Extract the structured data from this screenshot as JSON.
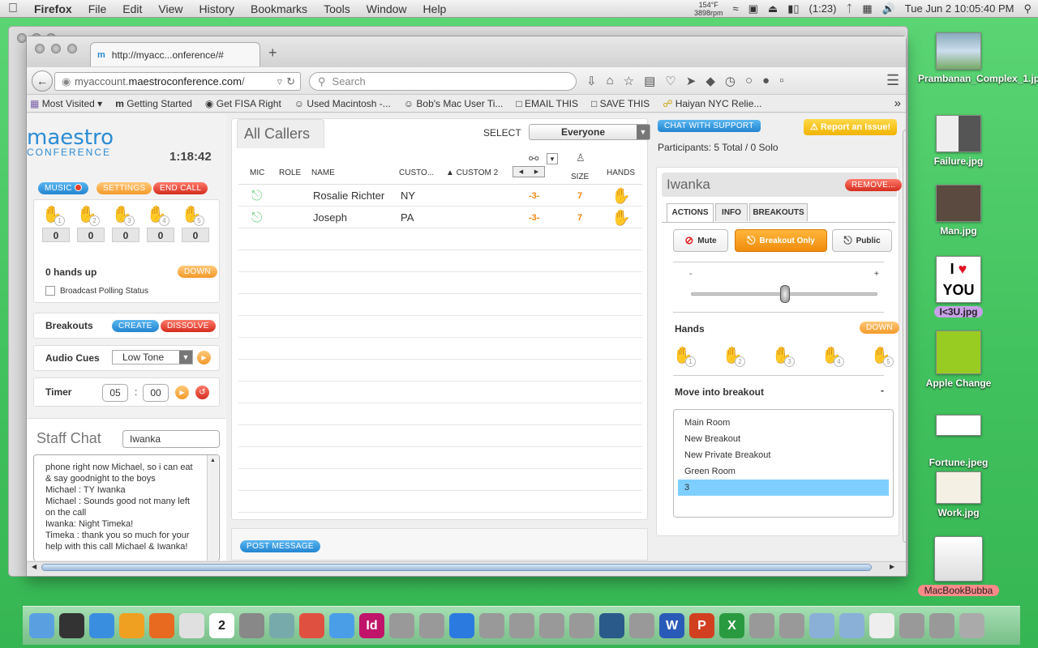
{
  "menubar": {
    "app": "Firefox",
    "items": [
      "File",
      "Edit",
      "View",
      "History",
      "Bookmarks",
      "Tools",
      "Window",
      "Help"
    ],
    "temp_line1": "154°F",
    "temp_line2": "3898rpm",
    "battery": "(1:23)",
    "datetime": "Tue Jun 2  10:05:40 PM"
  },
  "browser": {
    "tab_title": "http://myacc...onference/#",
    "new_tab": "+",
    "url_domain": "myaccount.",
    "url_bold": "maestroconference.com",
    "url_rest": "/",
    "search_placeholder": "Search",
    "bookmarks": [
      "Most Visited ▾",
      "Getting Started",
      "Get FISA Right",
      "Used Macintosh -...",
      "Bob's Mac User Ti...",
      "EMAIL THIS",
      "SAVE THIS",
      "Haiyan NYC Relie..."
    ],
    "overflow": "»"
  },
  "left": {
    "logo_top": "maestro",
    "logo_bottom": "CONFERENCE",
    "timer": "1:18:42",
    "music_label": "MUSIC",
    "settings_label": "SETTINGS",
    "end_call_label": "END CALL",
    "hand_counts": [
      "0",
      "0",
      "0",
      "0",
      "0"
    ],
    "hand_nums": [
      "1",
      "2",
      "3",
      "4",
      "5"
    ],
    "hands_up": "0 hands up",
    "down_label": "DOWN",
    "broadcast_label": "Broadcast Polling Status",
    "breakouts_label": "Breakouts",
    "create_label": "CREATE",
    "dissolve_label": "DISSOLVE",
    "audio_cues_label": "Audio Cues",
    "audio_cue_value": "Low Tone",
    "timer_label": "Timer",
    "timer_min": "05",
    "timer_sep": ":",
    "timer_sec": "00",
    "staff_chat_label": "Staff Chat",
    "staff_chat_name": "Iwanka",
    "chat_lines": [
      "phone right now Michael, so i can eat & say goodnight to the boys",
      "Michael : TY Iwanka",
      "Michael : Sounds good not many left on the call",
      "Iwanka: Night Timeka!",
      "Timeka : thank you so much for your help with this call Michael & Iwanka!"
    ]
  },
  "center": {
    "title": "All Callers",
    "select_label": "SELECT",
    "select_value": "Everyone",
    "col_mic": "MIC",
    "col_role": "ROLE",
    "col_name": "NAME",
    "col_custom1": "CUSTO...",
    "col_custom2": "▲ CUSTOM 2",
    "col_size": "SIZE",
    "col_hands": "HANDS",
    "callers": [
      {
        "name": "Rosalie Richter",
        "custom1": "NY",
        "custom2": "-3-",
        "size": "7"
      },
      {
        "name": "Joseph",
        "custom1": "PA",
        "custom2": "-3-",
        "size": "7"
      }
    ],
    "post_message": "POST MESSAGE"
  },
  "right": {
    "chat_support": "CHAT WITH SUPPORT",
    "report_issue": "⚠ Report an Issue!",
    "participants": "Participants: 5 Total / 0 Solo",
    "selected_name": "Iwanka",
    "remove_label": "REMOVE...",
    "tabs": [
      "ACTIONS",
      "INFO",
      "BREAKOUTS"
    ],
    "mute_label": "Mute",
    "breakout_only_label": "Breakout Only",
    "public_label": "Public",
    "slider_min": "-",
    "slider_max": "+",
    "slider_level": 0.5,
    "hands_label": "Hands",
    "hands_down": "DOWN",
    "hand_nums": [
      "1",
      "2",
      "3",
      "4",
      "5"
    ],
    "move_breakout_label": "Move into breakout",
    "move_collapse": "-",
    "breakouts": [
      "Main Room",
      "New Breakout",
      "New Private Breakout",
      "Green Room",
      "3"
    ]
  },
  "desktop": {
    "icons": [
      "Prambanan_Complex_1.jpg",
      "Failure.jpg",
      "Man.jpg",
      "I<3U.jpg",
      "Apple Change",
      "Fortune.jpeg",
      "Work.jpg",
      "MacBookBubba"
    ],
    "iloveyou_i": "I",
    "iloveyou_you": "YOU",
    "dock_apps": [
      "finder-icon",
      "dashboard-icon",
      "safari-icon",
      "itunes-icon",
      "firefox-icon",
      "textedit-icon",
      "calendar-icon",
      "utility-icon",
      "preview-icon",
      "home-icon",
      "mail-icon",
      "indesign-icon",
      "app-icon",
      "app-icon",
      "music-icon",
      "app-icon",
      "app-icon",
      "app-icon",
      "app-icon",
      "timemachine-icon",
      "app-icon",
      "word-icon",
      "powerpoint-icon",
      "excel-icon",
      "app-icon",
      "app-icon",
      "folder-icon",
      "folder-icon",
      "doc-icon",
      "app-icon",
      "app-icon",
      "trash-icon"
    ],
    "dock_letters": {
      "indesign": "Id",
      "word": "W",
      "powerpoint": "P",
      "excel": "X",
      "calendar": "2"
    }
  }
}
